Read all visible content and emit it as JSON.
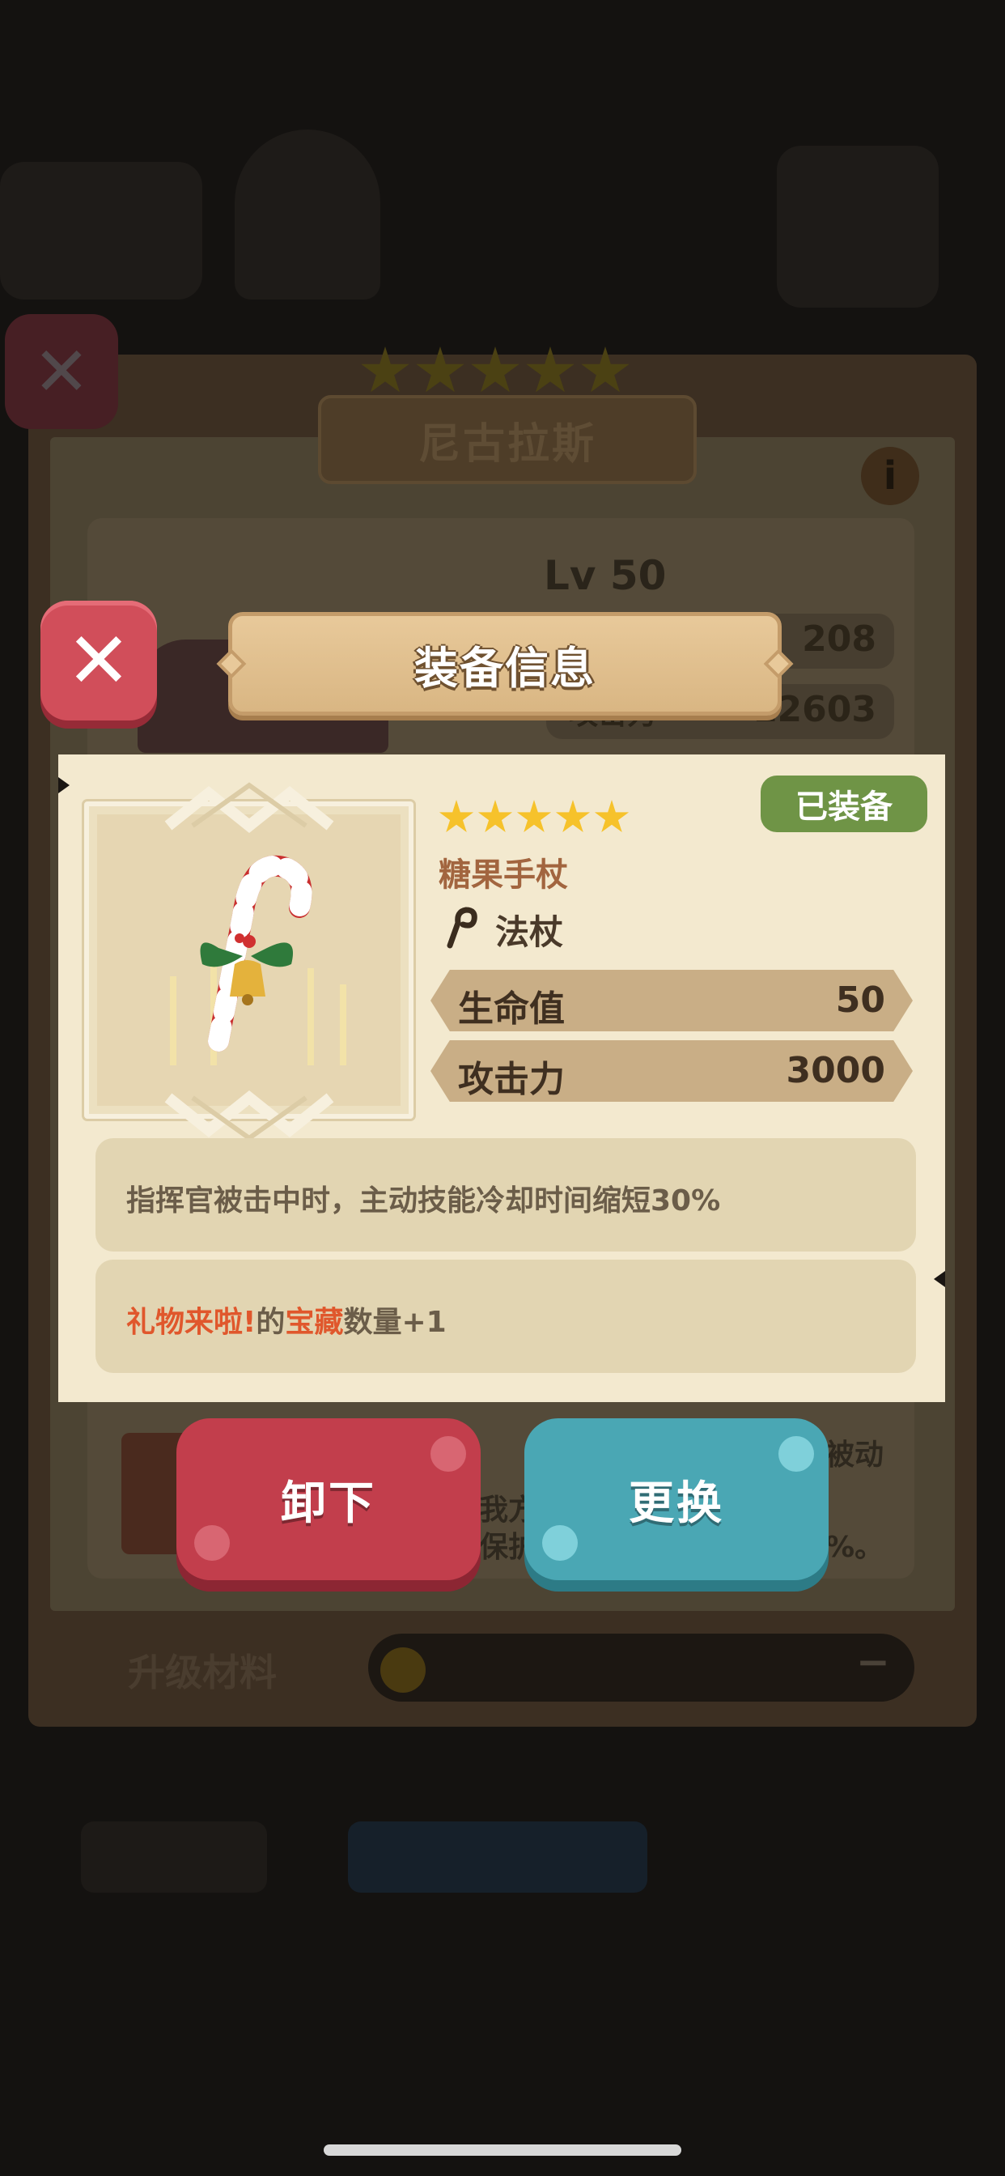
{
  "background": {
    "hero_name": "尼古拉斯",
    "level": "Lv 50",
    "stat1_value": "208",
    "stat2_label": "攻击力",
    "stat2_value": "12603",
    "side_text_1": "被动",
    "side_text_2": "我方",
    "side_text_3": "保护",
    "side_text_4": "%。",
    "material_label": "升级材料",
    "material_value": "−"
  },
  "dialog": {
    "title": "装备信息",
    "status_badge": "已装备",
    "item": {
      "stars": 5,
      "name": "糖果手杖",
      "type": "法杖",
      "stats": [
        {
          "name": "生命值",
          "value": "50"
        },
        {
          "name": "攻击力",
          "value": "3000"
        }
      ],
      "effect": "指挥官被击中时，主动技能冷却时间缩短30%",
      "bonus": {
        "part1": "礼物来啦!",
        "part2": "的",
        "part3": "宝藏",
        "part4": "数量+1"
      }
    },
    "buttons": {
      "unequip": "卸下",
      "replace": "更换"
    }
  },
  "colors": {
    "highlight": "#e0572c",
    "equipped_badge": "#6f9446",
    "unequip_button": "#c23e4c",
    "replace_button": "#4aa7b4"
  }
}
